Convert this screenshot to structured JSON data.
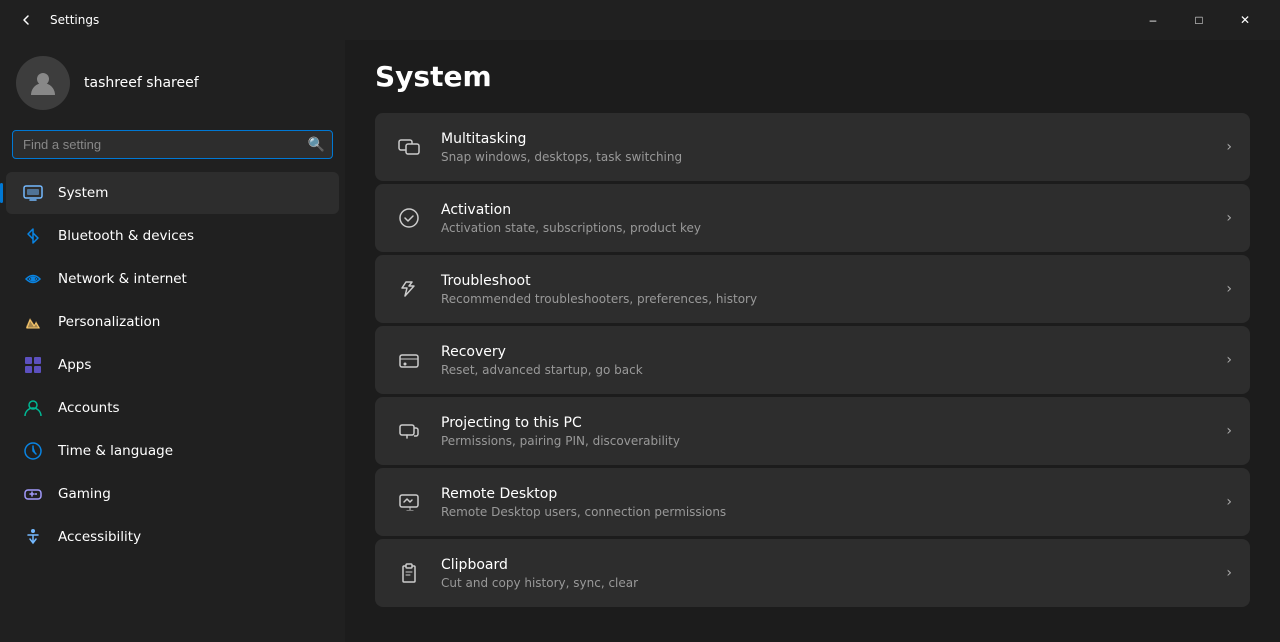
{
  "titleBar": {
    "title": "Settings",
    "minimizeLabel": "–",
    "maximizeLabel": "□",
    "closeLabel": "✕"
  },
  "sidebar": {
    "user": {
      "name": "tashreef shareef"
    },
    "search": {
      "placeholder": "Find a setting"
    },
    "navItems": [
      {
        "id": "system",
        "label": "System",
        "active": true
      },
      {
        "id": "bluetooth",
        "label": "Bluetooth & devices",
        "active": false
      },
      {
        "id": "network",
        "label": "Network & internet",
        "active": false
      },
      {
        "id": "personalization",
        "label": "Personalization",
        "active": false
      },
      {
        "id": "apps",
        "label": "Apps",
        "active": false
      },
      {
        "id": "accounts",
        "label": "Accounts",
        "active": false
      },
      {
        "id": "time",
        "label": "Time & language",
        "active": false
      },
      {
        "id": "gaming",
        "label": "Gaming",
        "active": false
      },
      {
        "id": "accessibility",
        "label": "Accessibility",
        "active": false
      }
    ]
  },
  "content": {
    "pageTitle": "System",
    "settings": [
      {
        "id": "multitasking",
        "title": "Multitasking",
        "subtitle": "Snap windows, desktops, task switching"
      },
      {
        "id": "activation",
        "title": "Activation",
        "subtitle": "Activation state, subscriptions, product key"
      },
      {
        "id": "troubleshoot",
        "title": "Troubleshoot",
        "subtitle": "Recommended troubleshooters, preferences, history"
      },
      {
        "id": "recovery",
        "title": "Recovery",
        "subtitle": "Reset, advanced startup, go back"
      },
      {
        "id": "projecting",
        "title": "Projecting to this PC",
        "subtitle": "Permissions, pairing PIN, discoverability"
      },
      {
        "id": "remotedesktop",
        "title": "Remote Desktop",
        "subtitle": "Remote Desktop users, connection permissions"
      },
      {
        "id": "clipboard",
        "title": "Clipboard",
        "subtitle": "Cut and copy history, sync, clear"
      }
    ]
  }
}
